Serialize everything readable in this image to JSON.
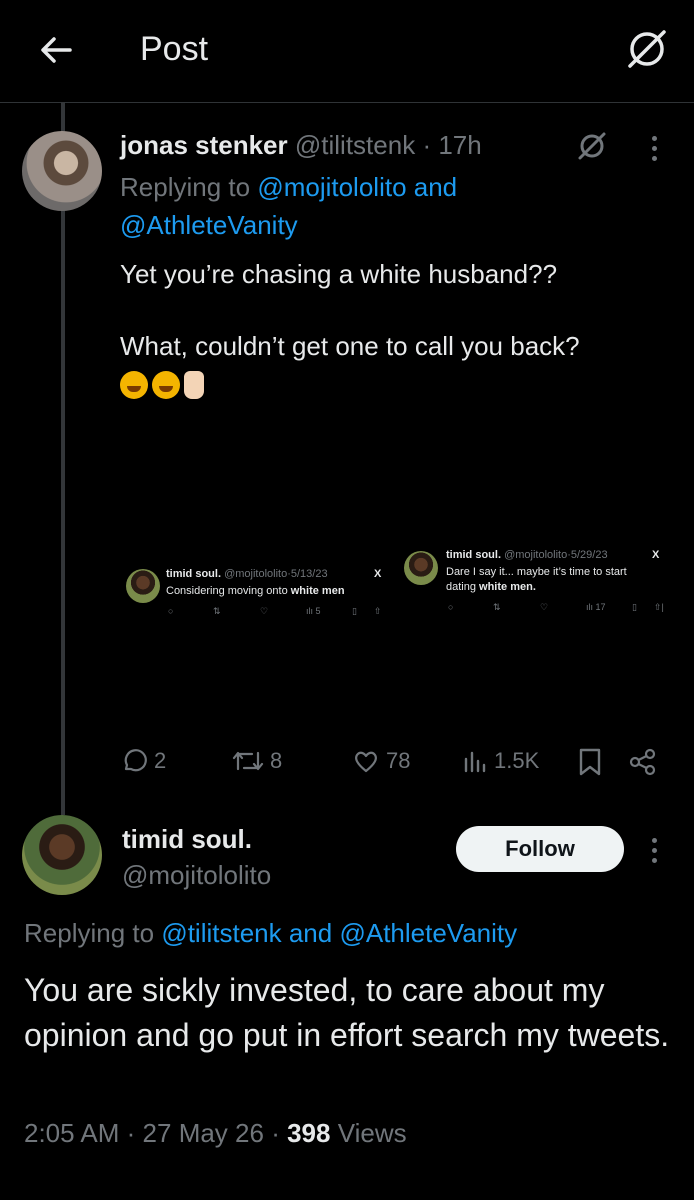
{
  "header": {
    "title": "Post"
  },
  "parent_post": {
    "display_name": "jonas stenker",
    "handle": "@tilitstenk",
    "separator": "·",
    "time": "17h",
    "replying_prefix": "Replying to",
    "replying_to_1": "@mojitololito and",
    "replying_to_2": "@AthleteVanity",
    "text_line1": "Yet you’re chasing a white husband??",
    "text_line2": "What, couldn’t get one to call you back?",
    "embedded": [
      {
        "name": "timid soul.",
        "handle_time": "@mojitololito·5/13/23",
        "x": "X",
        "text_plain": "Considering moving onto ",
        "text_bold": "white men",
        "views": "5"
      },
      {
        "name": "timid soul.",
        "handle_time": "@mojitololito·5/29/23",
        "x": "X",
        "text_line1": "Dare I say it... maybe it’s time to start",
        "text_plain": "dating ",
        "text_bold": "white men.",
        "views": "17"
      }
    ],
    "stats": {
      "replies": "2",
      "reposts": "8",
      "likes": "78",
      "views": "1.5K"
    }
  },
  "reply_post": {
    "display_name": "timid soul.",
    "handle": "@mojitololito",
    "follow_label": "Follow",
    "replying_prefix": "Replying to",
    "replying_to": "@tilitstenk and @AthleteVanity",
    "text": "You are sickly invested, to care about my opinion and go put in effort search my tweets.",
    "time": "2:05 AM",
    "dot": "·",
    "date": "27 May 26",
    "views_count": "398",
    "views_label": "Views"
  },
  "colors": {
    "background": "#000000",
    "text": "#e7e9ea",
    "muted": "#71767b",
    "accent": "#1d9bf0"
  },
  "icons": [
    "back-arrow-icon",
    "grok-icon",
    "more-icon",
    "reply-icon",
    "repost-icon",
    "like-icon",
    "views-icon",
    "bookmark-icon",
    "share-icon",
    "x-logo-icon"
  ]
}
